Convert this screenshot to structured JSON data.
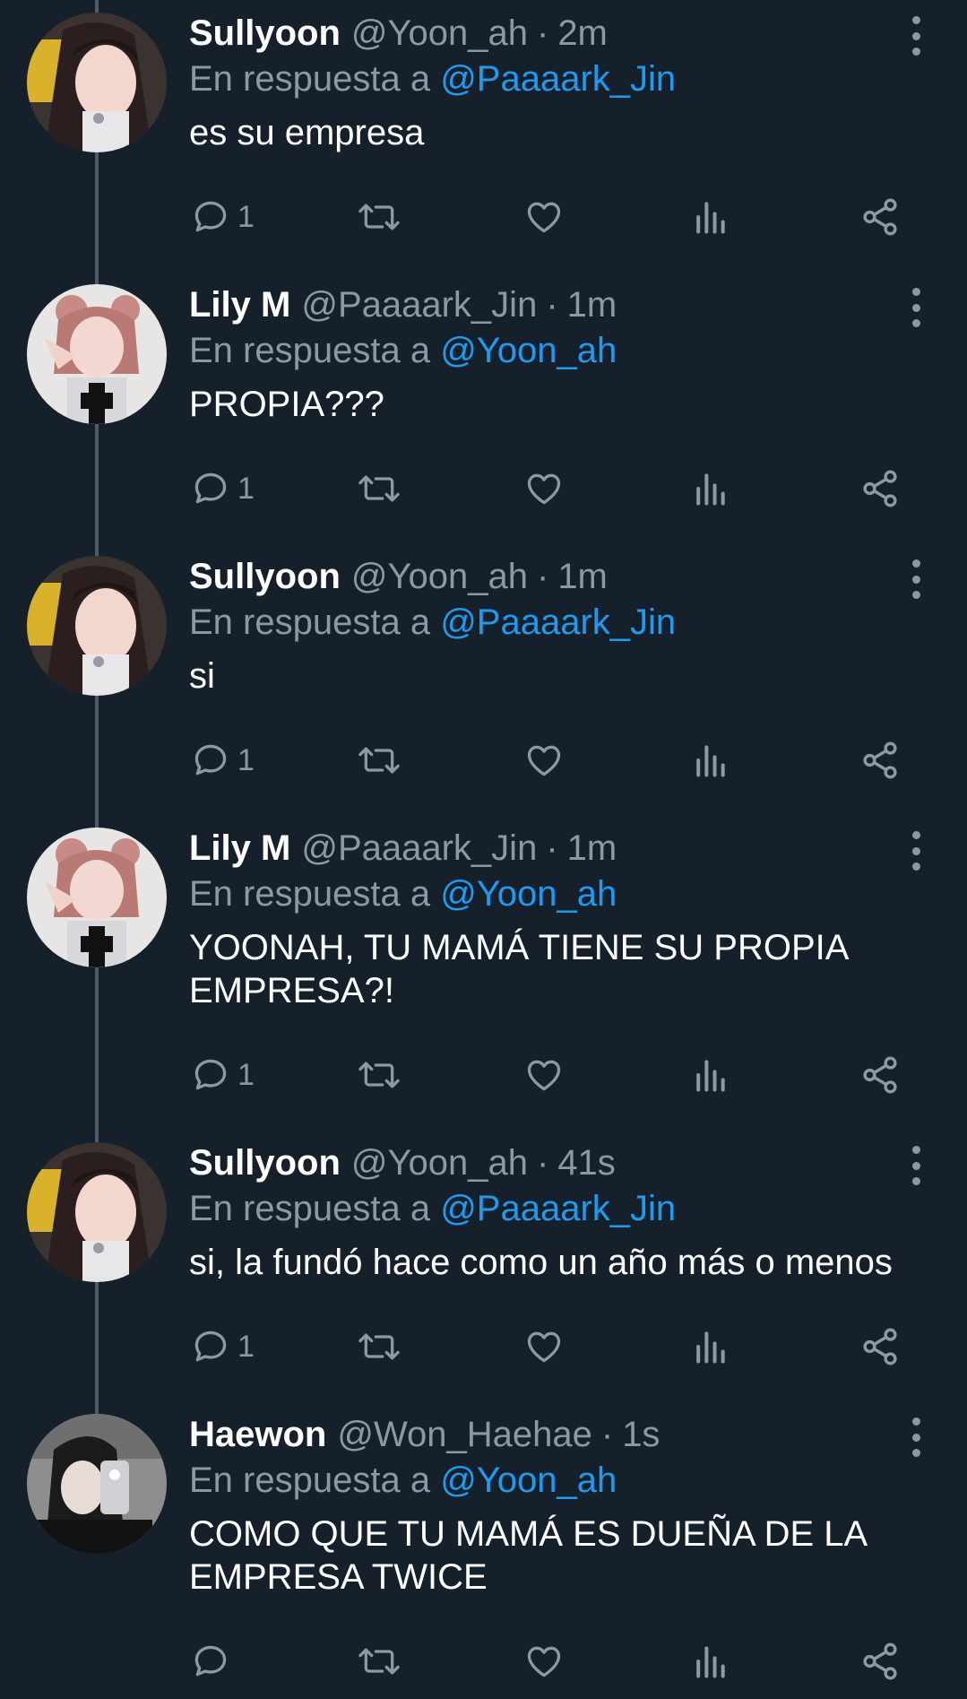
{
  "tweets": [
    {
      "author": "Sullyoon",
      "handle": "@Yoon_ah",
      "sep": "·",
      "time": "2m",
      "reply_prefix": "En respuesta a",
      "reply_to": "@Paaaark_Jin",
      "text": "es su empresa",
      "text2": "",
      "reply_count": "1",
      "avatar": "avatar-sullyoon"
    },
    {
      "author": "Lily M",
      "handle": "@Paaaark_Jin",
      "sep": "·",
      "time": "1m",
      "reply_prefix": "En respuesta a",
      "reply_to": "@Yoon_ah",
      "text": "PROPIA???",
      "text2": "",
      "reply_count": "1",
      "avatar": "avatar-lily"
    },
    {
      "author": "Sullyoon",
      "handle": "@Yoon_ah",
      "sep": "·",
      "time": "1m",
      "reply_prefix": "En respuesta a",
      "reply_to": "@Paaaark_Jin",
      "text": "si",
      "text2": "",
      "reply_count": "1",
      "avatar": "avatar-sullyoon"
    },
    {
      "author": "Lily M",
      "handle": "@Paaaark_Jin",
      "sep": "·",
      "time": "1m",
      "reply_prefix": "En respuesta a",
      "reply_to": "@Yoon_ah",
      "text": "YOONAH, TU MAMÁ TIENE SU PROPIA",
      "text2": "EMPRESA?!",
      "reply_count": "1",
      "avatar": "avatar-lily"
    },
    {
      "author": "Sullyoon",
      "handle": "@Yoon_ah",
      "sep": "·",
      "time": "41s",
      "reply_prefix": "En respuesta a",
      "reply_to": "@Paaaark_Jin",
      "text": "si, la fundó hace como un año más o menos",
      "text2": "",
      "reply_count": "1",
      "avatar": "avatar-sullyoon"
    },
    {
      "author": "Haewon",
      "handle": "@Won_Haehae",
      "sep": "·",
      "time": "1s",
      "reply_prefix": "En respuesta a",
      "reply_to": "@Yoon_ah",
      "text": "COMO QUE TU MAMÁ ES DUEÑA DE LA",
      "text2": "EMPRESA TWICE",
      "reply_count": "",
      "avatar": "avatar-haewon"
    }
  ],
  "colors": {
    "background": "#15202b",
    "mention": "#1d9bf0",
    "secondary_text": "#8b98a5",
    "thread_line": "#4e5c69"
  },
  "icons": [
    "reply-icon",
    "retweet-icon",
    "like-icon",
    "views-icon",
    "share-icon",
    "more-options-icon"
  ]
}
